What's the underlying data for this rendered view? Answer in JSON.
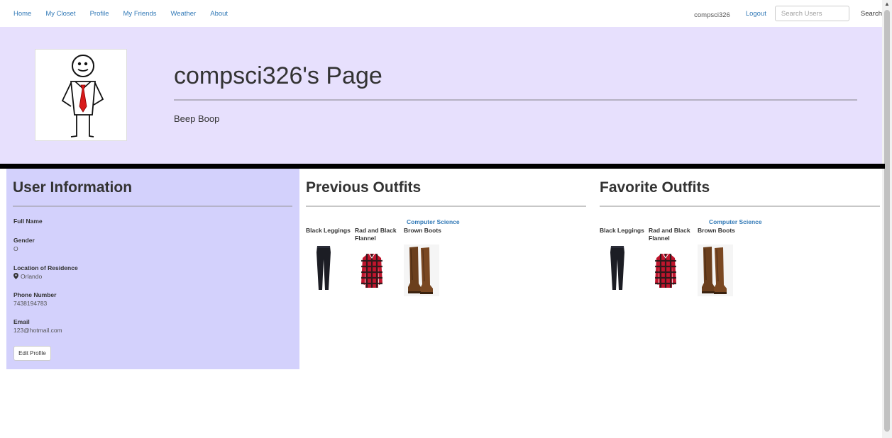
{
  "nav": {
    "links": [
      "Home",
      "My Closet",
      "Profile",
      "My Friends",
      "Weather",
      "About"
    ],
    "username": "compsci326",
    "logout": "Logout",
    "search_placeholder": "Search Users",
    "search_button": "Search"
  },
  "banner": {
    "title": "compsci326's Page",
    "subtitle": "Beep Boop",
    "avatar_icon": "stick-figure-avatar"
  },
  "user_info": {
    "title": "User Information",
    "fields": [
      {
        "label": "Full Name",
        "value": ""
      },
      {
        "label": "Gender",
        "value": "O"
      },
      {
        "label": "Location of Residence",
        "value": "Orlando"
      },
      {
        "label": "Phone Number",
        "value": "7438194783"
      },
      {
        "label": "Email",
        "value": "123@hotmail.com"
      }
    ],
    "edit_button": "Edit Profile"
  },
  "previous_outfits": {
    "title": "Previous Outfits",
    "outfit_name": "Computer Science",
    "items": [
      "Black Leggings",
      "Rad and Black Flannel",
      "Brown Boots"
    ]
  },
  "favorite_outfits": {
    "title": "Favorite Outfits",
    "outfit_name": "Computer Science",
    "items": [
      "Black Leggings",
      "Rad and Black Flannel",
      "Brown Boots"
    ]
  },
  "colors": {
    "link": "#337ab7",
    "banner_bg": "#e7e0fd",
    "info_panel_bg": "#d3d1fc"
  }
}
